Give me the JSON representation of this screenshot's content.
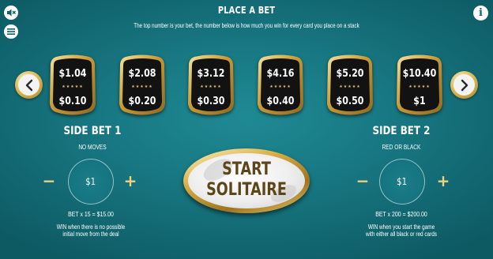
{
  "header": {
    "title": "PLACE A BET",
    "subtitle": "The top number is your bet, the number below is how much you win for every card you place on a stack"
  },
  "icons": {
    "sound": "sound-muted-icon",
    "menu": "hamburger-menu-icon",
    "info": "info-icon",
    "info_glyph": "i",
    "left_arrow": "chevron-left-icon",
    "right_arrow": "chevron-right-icon"
  },
  "cards": [
    {
      "bet": "$1.04",
      "win": "$0.10"
    },
    {
      "bet": "$2.08",
      "win": "$0.20"
    },
    {
      "bet": "$3.12",
      "win": "$0.30"
    },
    {
      "bet": "$4.16",
      "win": "$0.40"
    },
    {
      "bet": "$5.20",
      "win": "$0.50"
    },
    {
      "bet": "$10.40",
      "win": "$1"
    }
  ],
  "card_stars": "★★★★★",
  "side_bet_1": {
    "title": "SIDE BET 1",
    "subtitle": "NO MOVES",
    "value": "$1",
    "minus": "−",
    "plus": "+",
    "bet_line": "BET x 15 = $15.00",
    "win_line_1": "WIN when there is no possible",
    "win_line_2": "initial move from the deal"
  },
  "side_bet_2": {
    "title": "SIDE BET 2",
    "subtitle": "RED OR BLACK",
    "value": "$1",
    "minus": "−",
    "plus": "+",
    "bet_line": "BET x 200 = $200.00",
    "win_line_1": "WIN when you start the game",
    "win_line_2": "with either all black or red cards"
  },
  "start_button": {
    "line1": "START",
    "line2": "SOLITAIRE"
  },
  "colors": {
    "background": "#177681",
    "gold": "#d8ad43",
    "card_face": "#111111",
    "plus_minus": "#f0d27a"
  }
}
